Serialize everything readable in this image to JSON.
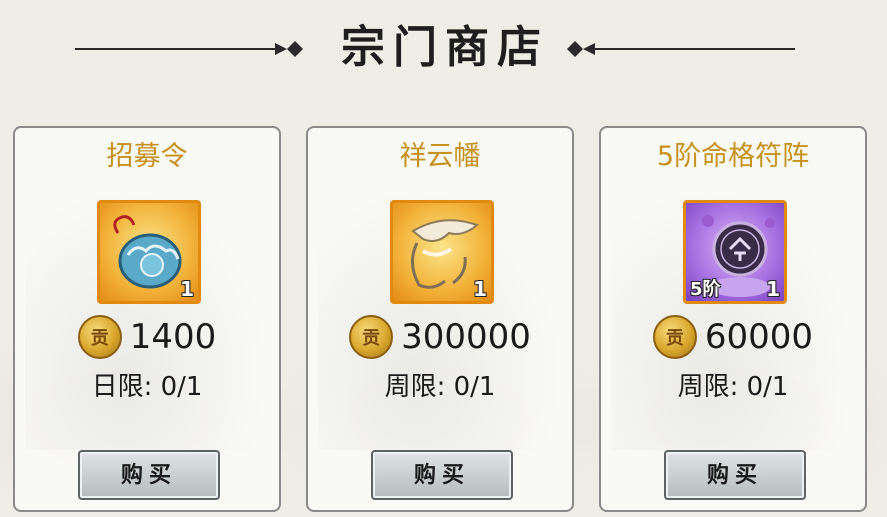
{
  "header": {
    "title": "宗门商店"
  },
  "shop": {
    "items": [
      {
        "name": "招募令",
        "icon": "recruit-token-icon",
        "quantity": "1",
        "currency_icon": "贡",
        "price": "1400",
        "limit": "日限: 0/1",
        "buy_label": "购买"
      },
      {
        "name": "祥云幡",
        "icon": "cloud-banner-icon",
        "quantity": "1",
        "currency_icon": "贡",
        "price": "300000",
        "limit": "周限: 0/1",
        "buy_label": "购买"
      },
      {
        "name": "5阶命格符阵",
        "icon": "fate-array-icon",
        "quantity": "1",
        "tier": "5阶",
        "currency_icon": "贡",
        "price": "60000",
        "limit": "周限: 0/1",
        "buy_label": "购买"
      }
    ]
  },
  "colors": {
    "item_name": "#c7911e",
    "background": "#efeee6",
    "card_border": "#8a8a8a"
  }
}
